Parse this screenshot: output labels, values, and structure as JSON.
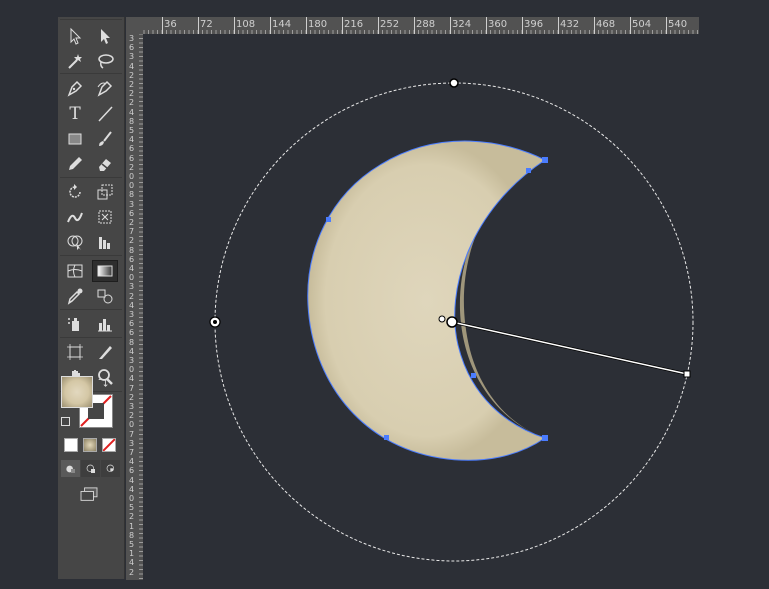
{
  "ruler": {
    "top_ticks": [
      "36",
      "72",
      "108",
      "144",
      "180",
      "216",
      "252",
      "288",
      "324",
      "360",
      "396",
      "432",
      "468",
      "504",
      "540"
    ],
    "left_digits": [
      "3",
      "6",
      "3",
      "4",
      "2",
      "2",
      "2",
      "2",
      "4",
      "8",
      "5",
      "4",
      "6",
      "6",
      "2",
      "0",
      "0",
      "8",
      "3",
      "6",
      "2",
      "7",
      "2",
      "8",
      "6",
      "4",
      "0",
      "3",
      "2",
      "4",
      "3",
      "6",
      "6",
      "8",
      "4",
      "3",
      "0",
      "4",
      "7",
      "2",
      "3",
      "2",
      "0",
      "7",
      "3",
      "7",
      "4",
      "6",
      "4",
      "4",
      "0",
      "5",
      "2",
      "1",
      "8",
      "5",
      "1",
      "4",
      "2"
    ]
  },
  "toolbar": {
    "tools": [
      {
        "name": "selection-tool-icon"
      },
      {
        "name": "direct-selection-tool-icon"
      },
      {
        "name": "magic-wand-tool-icon"
      },
      {
        "name": "lasso-tool-icon"
      },
      {
        "name": "pen-tool-icon"
      },
      {
        "name": "curvature-tool-icon"
      },
      {
        "name": "type-tool-icon",
        "label": "T"
      },
      {
        "name": "line-segment-tool-icon"
      },
      {
        "name": "rectangle-tool-icon"
      },
      {
        "name": "paintbrush-tool-icon"
      },
      {
        "name": "pencil-tool-icon"
      },
      {
        "name": "eraser-tool-icon"
      },
      {
        "name": "rotate-tool-icon"
      },
      {
        "name": "scale-tool-icon"
      },
      {
        "name": "warp-tool-icon"
      },
      {
        "name": "free-transform-tool-icon"
      },
      {
        "name": "shape-builder-tool-icon"
      },
      {
        "name": "perspective-grid-tool-icon"
      },
      {
        "name": "mesh-tool-icon"
      },
      {
        "name": "gradient-tool-icon"
      },
      {
        "name": "eyedropper-tool-icon"
      },
      {
        "name": "blend-tool-icon"
      },
      {
        "name": "symbol-sprayer-tool-icon"
      },
      {
        "name": "column-graph-tool-icon"
      },
      {
        "name": "artboard-tool-icon"
      },
      {
        "name": "slice-tool-icon"
      },
      {
        "name": "hand-tool-icon"
      },
      {
        "name": "zoom-tool-icon"
      }
    ],
    "colors": {
      "fill": "#d9cfb4",
      "stroke": "none"
    }
  },
  "artwork": {
    "moon_fill": "#dcd3b7",
    "moon_shadow": "#9e9378",
    "path_color": "#4a7cff",
    "gradient_annotator": "#ffffff"
  }
}
